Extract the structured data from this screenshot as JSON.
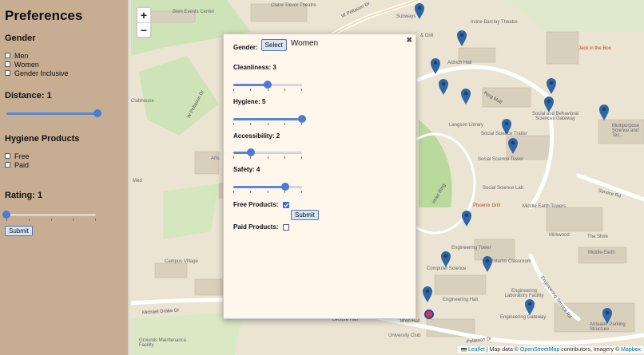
{
  "sidebar": {
    "title": "Preferences",
    "gender": {
      "heading": "Gender",
      "options": [
        "Men",
        "Women",
        "Gender Inclusive"
      ]
    },
    "distance": {
      "label": "Distance: 1",
      "value": 1,
      "fraction": 1.0
    },
    "hygiene": {
      "heading": "Hygiene Products",
      "options": [
        "Free",
        "Paid"
      ]
    },
    "rating": {
      "label": "Rating: 1",
      "value": 1,
      "fraction": 0.0
    },
    "submit_label": "Submit"
  },
  "map": {
    "zoom_in": "+",
    "zoom_out": "−",
    "labels": {
      "l1": "Bren Events Center",
      "l2": "Claire Trevor Theatre",
      "l3": "W Peltason Dr",
      "l4": "Subways",
      "l5": "& Grill",
      "l6": "Irvine Barclay Theatre",
      "l7": "Aldrich Hall",
      "l8": "Jack in the Box",
      "l9": "W Peltason Dr",
      "l10": "Ring Mall",
      "l11": "Langson Library",
      "l12": "Social and Behavioral Sciences Gateway",
      "l13": "Multipurpose Science and Tec...",
      "l14": "Social Science Trailer",
      "l15": "Social Science Tower",
      "l16": "Social Science Lab",
      "l17": "Service Rd",
      "l18": "Phoenix Grill",
      "l19": "Middle Earth Towers",
      "l20": "Mirkwood",
      "l21": "The Shire",
      "l22": "Middle Earth",
      "l23": "Engineering Tower",
      "l24": "Computer Science",
      "l25": "Interim Classroom",
      "l26": "Engineering Hall",
      "l27": "Engineering Laboratory Facility",
      "l28": "Engineering Gateway",
      "l29": "Anteater Parking Structure",
      "l30": "Bren Hall",
      "l31": "Lecture Hall",
      "l32": "University Club",
      "l33": "Campus Village",
      "l34": "Michael Drake Dr",
      "l35": "Grounds Maintenance Facility",
      "l36": "Arts",
      "l37": "Med",
      "l38": "Clubhouse",
      "l39": "Inner Ring",
      "l40": "Engineering Service Rd",
      "l41": "Peltason Dr"
    },
    "attribution": {
      "leaflet": "Leaflet",
      "text1": " | Map data © ",
      "osm": "OpenStreetMap",
      "text2": " contributors, Imagery © ",
      "mapbox": "Mapbox"
    },
    "marker_color": "#2f66a6"
  },
  "popup": {
    "close": "✖",
    "gender_label": "Gender:",
    "select_label": "Select",
    "gender_value": "Women",
    "cleanliness": {
      "label": "Cleanliness: 3",
      "value": 3,
      "fraction": 0.5
    },
    "hygiene": {
      "label": "Hygiene: 5",
      "value": 5,
      "fraction": 1.0
    },
    "accessibility": {
      "label": "Accessibility: 2",
      "value": 2,
      "fraction": 0.25
    },
    "safety": {
      "label": "Safety: 4",
      "value": 4,
      "fraction": 0.75
    },
    "free_products_label": "Free Products:",
    "free_products_checked": true,
    "submit_label": "Submit",
    "paid_products_label": "Paid Products:",
    "paid_products_checked": false
  }
}
